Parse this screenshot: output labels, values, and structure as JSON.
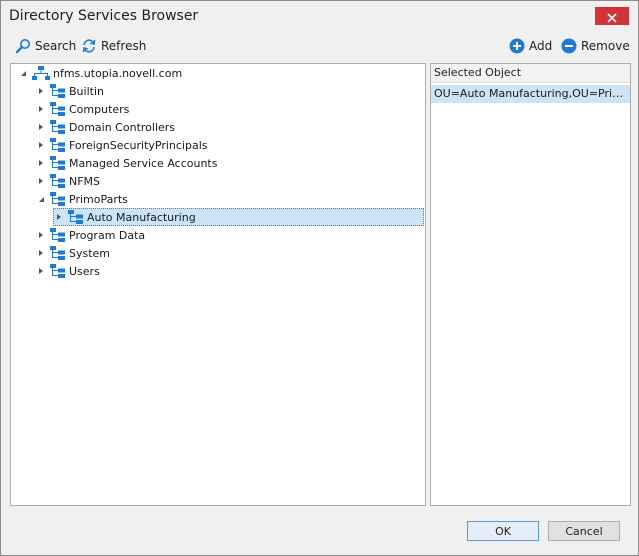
{
  "window": {
    "title": "Directory Services Browser"
  },
  "toolbar": {
    "search_label": "Search",
    "refresh_label": "Refresh",
    "add_label": "Add",
    "remove_label": "Remove"
  },
  "tree": {
    "root": {
      "label": "nfms.utopia.novell.com",
      "expanded": true
    },
    "nodes": [
      {
        "label": "Builtin",
        "expanded": false
      },
      {
        "label": "Computers",
        "expanded": false
      },
      {
        "label": "Domain Controllers",
        "expanded": false
      },
      {
        "label": "ForeignSecurityPrincipals",
        "expanded": false
      },
      {
        "label": "Managed Service Accounts",
        "expanded": false
      },
      {
        "label": "NFMS",
        "expanded": false
      },
      {
        "label": "PrimoParts",
        "expanded": true
      },
      {
        "label": "Auto Manufacturing",
        "expanded": false,
        "selected": true
      },
      {
        "label": "Program Data",
        "expanded": false
      },
      {
        "label": "System",
        "expanded": false
      },
      {
        "label": "Users",
        "expanded": false
      }
    ]
  },
  "selected_panel": {
    "header": "Selected Object",
    "items": [
      "OU=Auto Manufacturing,OU=PrimoP..."
    ]
  },
  "buttons": {
    "ok_label": "OK",
    "cancel_label": "Cancel"
  },
  "colors": {
    "accent": "#1e7bd7",
    "close": "#d13438",
    "selection": "#cce4f7"
  }
}
